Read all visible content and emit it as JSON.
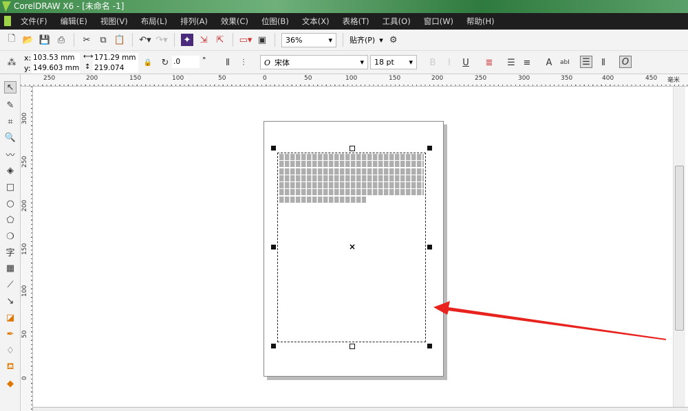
{
  "window": {
    "title": "CorelDRAW X6 - [未命名 -1]"
  },
  "menu": [
    "文件(F)",
    "编辑(E)",
    "视图(V)",
    "布局(L)",
    "排列(A)",
    "效果(C)",
    "位图(B)",
    "文本(X)",
    "表格(T)",
    "工具(O)",
    "窗口(W)",
    "帮助(H)"
  ],
  "toolbar": {
    "zoom": "36%",
    "snap": "贴齐(P)"
  },
  "props": {
    "x": "103.53 mm",
    "y": "149.603 mm",
    "width": "171.29 mm",
    "height": "219.074 mm",
    "rotation": ".0",
    "degree": "°",
    "font": "宋体",
    "size": "18 pt"
  },
  "ruler": {
    "h": [
      "250",
      "200",
      "150",
      "100",
      "50",
      "0",
      "50",
      "100",
      "150",
      "200",
      "250",
      "300",
      "350",
      "400",
      "450"
    ],
    "unit": "毫米",
    "v": [
      "300",
      "250",
      "200",
      "150",
      "100",
      "50",
      "0"
    ]
  },
  "colors": {
    "arrow": "#e8231e",
    "titlebar": "#3e8a4a",
    "menubar": "#1e1e1e"
  }
}
